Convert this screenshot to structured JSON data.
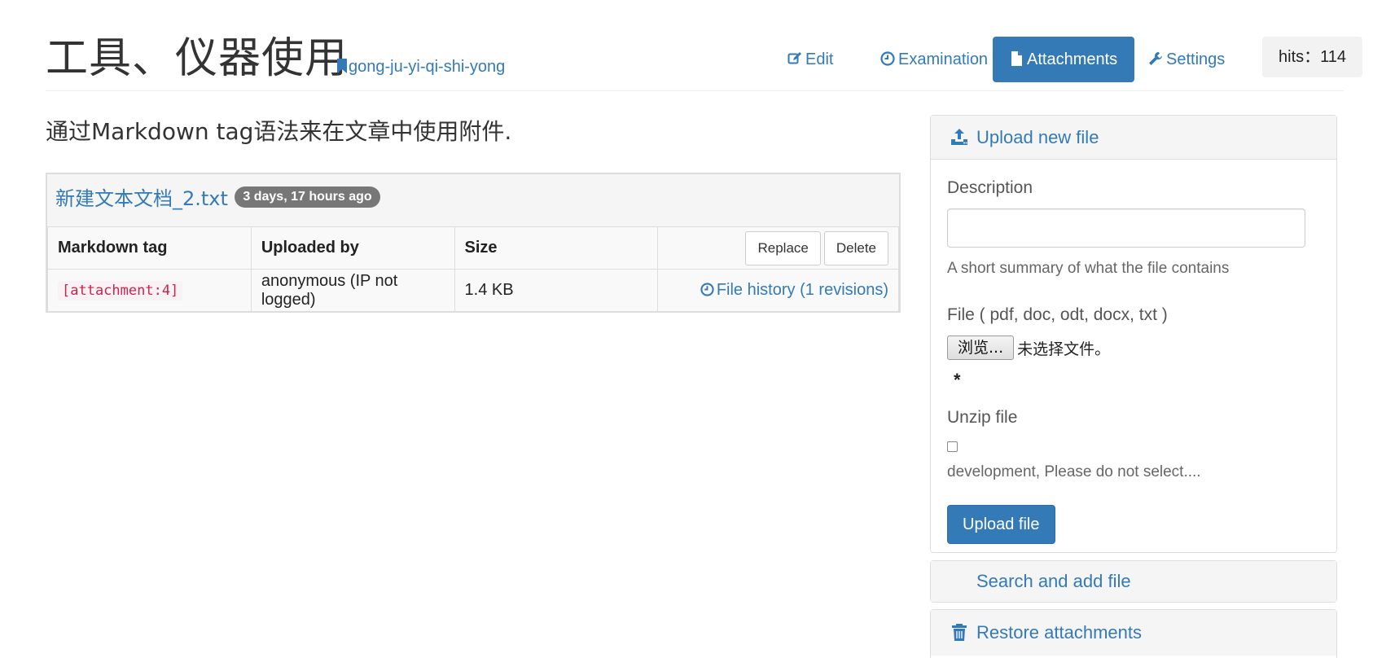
{
  "header": {
    "title": "工具、仪器使用",
    "slug": "gong-ju-yi-qi-shi-yong",
    "nav": [
      {
        "label": "Edit",
        "icon": "edit-icon"
      },
      {
        "label": "Examination",
        "icon": "clock-icon"
      },
      {
        "label": "Attachments",
        "icon": "file-icon",
        "active": true
      },
      {
        "label": "Settings",
        "icon": "wrench-icon"
      }
    ],
    "hits": "hits：114"
  },
  "main": {
    "lead": "通过Markdown tag语法来在文章中使用附件.",
    "attachment": {
      "file_name": "新建文本文档_2.txt",
      "age_badge": "3 days, 17 hours ago",
      "columns": [
        "Markdown tag",
        "Uploaded by",
        "Size"
      ],
      "row": {
        "tag": "[attachment:4]",
        "uploaded_by": "anonymous (IP not logged)",
        "size": "1.4 KB"
      },
      "replace_label": "Replace",
      "delete_label": "Delete",
      "history_label": "File history (1 revisions)"
    }
  },
  "sidebar": {
    "upload_title": "Upload new file",
    "description_label": "Description",
    "description_value": "",
    "description_help": "A short summary of what the file contains",
    "file_label": "File ( pdf, doc, odt, docx, txt )",
    "browse_label": "浏览...",
    "no_file_label": "未选择文件。",
    "required_mark": "*",
    "unzip_label": "Unzip file",
    "unzip_checked": false,
    "unzip_help": "development, Please do not select....",
    "upload_button": "Upload file",
    "search_title": "Search and add file",
    "restore_title": "Restore attachments"
  },
  "colors": {
    "primary": "#337ab7",
    "badge": "#777777",
    "code": "#c7254e"
  }
}
